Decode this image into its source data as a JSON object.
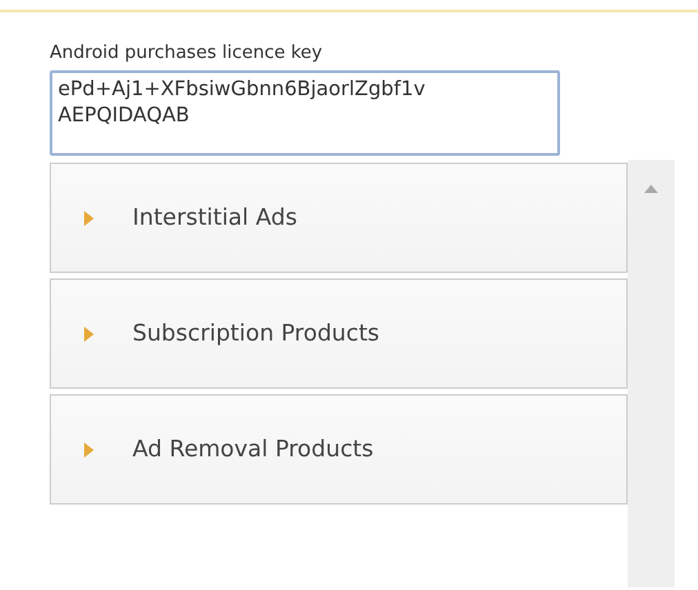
{
  "licence_key": {
    "label": "Android purchases licence key",
    "value": "ePd+Aj1+XFbsiwGbnn6BjaorlZgbf1v\nAEPQIDAQAB"
  },
  "sections": [
    {
      "title": "Interstitial Ads",
      "expanded": false
    },
    {
      "title": "Subscription Products",
      "expanded": false
    },
    {
      "title": "Ad Removal Products",
      "expanded": false
    }
  ]
}
